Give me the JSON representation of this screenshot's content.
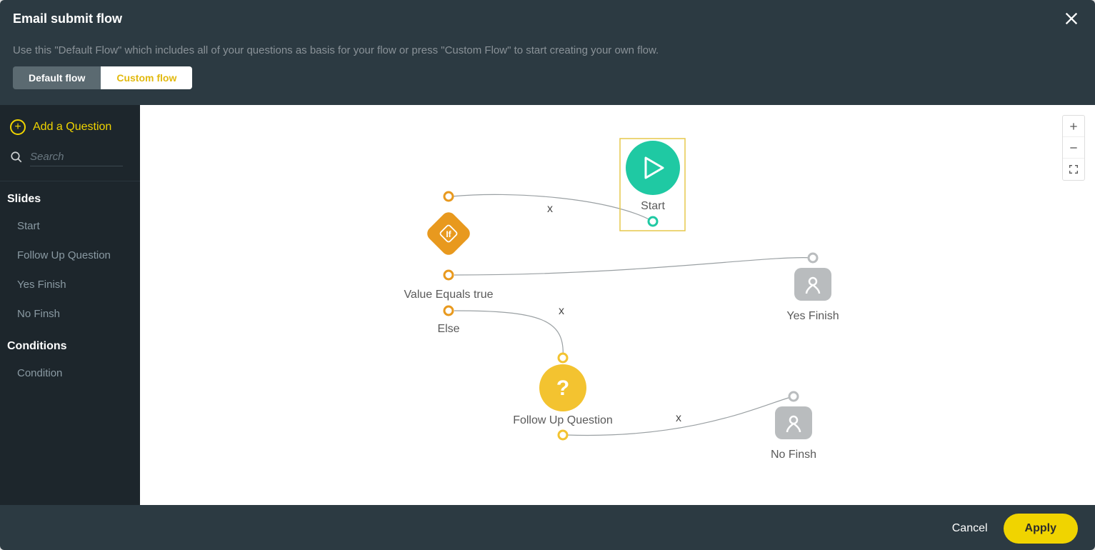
{
  "header": {
    "title": "Email submit flow"
  },
  "subheader": {
    "info": "Use this \"Default Flow\" which includes all of your questions as basis for your flow or press \"Custom Flow\" to start creating your own flow.",
    "toggle": {
      "default": "Default flow",
      "custom": "Custom flow"
    }
  },
  "sidebar": {
    "add_question": "Add a Question",
    "search_placeholder": "Search",
    "sections": [
      {
        "title": "Slides",
        "items": [
          "Start",
          "Follow Up Question",
          "Yes Finish",
          "No Finsh"
        ]
      },
      {
        "title": "Conditions",
        "items": [
          "Condition"
        ]
      }
    ]
  },
  "canvas": {
    "nodes": {
      "start": {
        "label": "Start",
        "color": "#1fc9a3"
      },
      "condition": {
        "label": "If",
        "color": "#e8991e",
        "branches": [
          "Value Equals true",
          "Else"
        ]
      },
      "followup": {
        "label": "Follow Up Question",
        "color": "#f3c330"
      },
      "yes_finish": {
        "label": "Yes Finish",
        "color": "#b9bcbe"
      },
      "no_finish": {
        "label": "No Finsh",
        "color": "#b9bcbe"
      }
    },
    "edge_close_glyph": "x"
  },
  "footer": {
    "cancel": "Cancel",
    "apply": "Apply"
  },
  "colors": {
    "accent_yellow": "#f0d400",
    "dark": "#2c3a42",
    "darker": "#1d262c"
  }
}
